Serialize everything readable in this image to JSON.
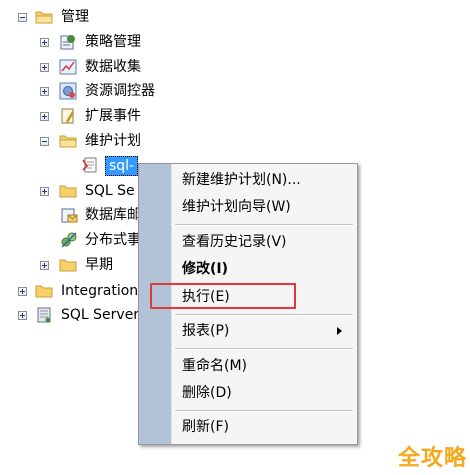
{
  "tree": {
    "root_label": "管理",
    "items": [
      {
        "label": "策略管理"
      },
      {
        "label": "数据收集"
      },
      {
        "label": "资源调控器"
      },
      {
        "label": "扩展事件"
      },
      {
        "label": "维护计划"
      },
      {
        "label": "sql-"
      },
      {
        "label": "SQL Se"
      },
      {
        "label": "数据库邮"
      },
      {
        "label": "分布式事"
      },
      {
        "label": "早期"
      },
      {
        "label": "Integration"
      },
      {
        "label": "SQL Server"
      }
    ]
  },
  "context_menu": {
    "items": [
      {
        "label": "新建维护计划(N)..."
      },
      {
        "label": "维护计划向导(W)"
      },
      {
        "label": "查看历史记录(V)"
      },
      {
        "label": "修改(I)"
      },
      {
        "label": "执行(E)"
      },
      {
        "label": "报表(P)"
      },
      {
        "label": "重命名(M)"
      },
      {
        "label": "删除(D)"
      },
      {
        "label": "刷新(F)"
      }
    ]
  },
  "watermark": "全攻略",
  "colors": {
    "selection": "#3399ff",
    "highlight_border": "#e0393e",
    "menu_gutter": "#b2c3d8",
    "watermark": "#f5a81c"
  }
}
